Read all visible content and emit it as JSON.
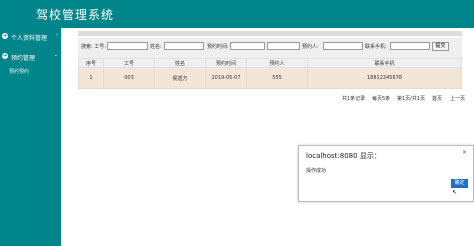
{
  "app": {
    "title": "驾校管理系统"
  },
  "sidebar": {
    "items": [
      {
        "label": "个人资料管理"
      },
      {
        "label": "预约管理"
      }
    ],
    "subitem": "预约预约"
  },
  "search": {
    "labels": [
      "搜索: 工号:",
      "姓名:",
      "预约时间:",
      "预约人:",
      "联系手机:"
    ],
    "button": "提交"
  },
  "table": {
    "headers": [
      "序号",
      "工号",
      "姓名",
      "预约时间",
      "预约人",
      "联系手机"
    ],
    "rows": [
      [
        "1",
        "003",
        "侯遗方",
        "2019-05-07",
        "555",
        "18812345678"
      ]
    ]
  },
  "pager": {
    "summary": "共1条记录",
    "per_page": "每页5条",
    "page_info": "第1页/共1页",
    "first": "首页",
    "prev": "上一页"
  },
  "dialog": {
    "title": "localhost:8080 显示：",
    "message": "操作成功",
    "ok": "确定",
    "close": "×"
  }
}
